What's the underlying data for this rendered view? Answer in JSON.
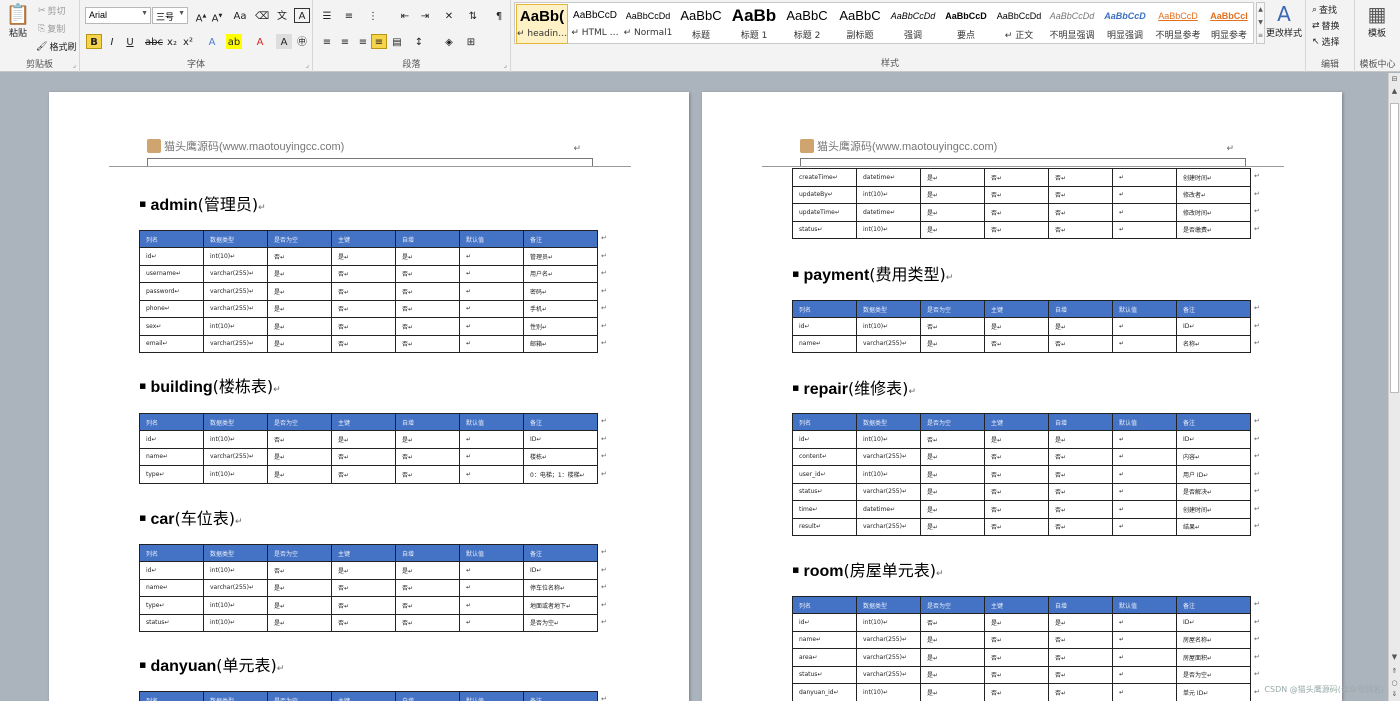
{
  "ribbon": {
    "clipboard": {
      "paste": "粘贴",
      "cut": "剪切",
      "copy": "复制",
      "format_painter": "格式刷",
      "label": "剪贴板"
    },
    "font": {
      "name": "Arial",
      "size": "三号",
      "label": "字体"
    },
    "paragraph": {
      "label": "段落"
    },
    "styles": {
      "label": "样式",
      "items": [
        {
          "preview": "AaBb(",
          "name": "↵ headin…"
        },
        {
          "preview": "AaBbCcD",
          "name": "↵ HTML …"
        },
        {
          "preview": "AaBbCcDd",
          "name": "↵ Normal1"
        },
        {
          "preview": "AaBbC",
          "name": "标题"
        },
        {
          "preview": "AaBb",
          "name": "标题 1"
        },
        {
          "preview": "AaBbC",
          "name": "标题 2"
        },
        {
          "preview": "AaBbC",
          "name": "副标题"
        },
        {
          "preview": "AaBbCcDd",
          "name": "强调"
        },
        {
          "preview": "AaBbCcD",
          "name": "要点"
        },
        {
          "preview": "AaBbCcDd",
          "name": "↵ 正文"
        },
        {
          "preview": "AaBbCcDd",
          "name": "不明显强调"
        },
        {
          "preview": "AaBbCcD",
          "name": "明显强调"
        },
        {
          "preview": "AaBbCcD",
          "name": "不明显参考"
        },
        {
          "preview": "AaBbCcI",
          "name": "明显参考"
        }
      ],
      "change_styles": "更改样式"
    },
    "editing": {
      "find": "查找",
      "replace": "替换",
      "select": "选择",
      "label": "编辑"
    },
    "templates": {
      "button": "模板",
      "label": "模板中心"
    }
  },
  "document": {
    "header_text": "猫头鹰源码(www.maotouyingcc.com)",
    "para_mark": "↵",
    "columns": [
      "列名",
      "数据类型",
      "是否为空",
      "主键",
      "自增",
      "默认值",
      "备注"
    ],
    "page1": [
      {
        "name": "admin",
        "cn": "(管理员)",
        "rows": [
          [
            "id↵",
            "int(10)↵",
            "否↵",
            "是↵",
            "是↵",
            "↵",
            "管理员↵"
          ],
          [
            "username↵",
            "varchar(255)↵",
            "是↵",
            "否↵",
            "否↵",
            "↵",
            "用户名↵"
          ],
          [
            "password↵",
            "varchar(255)↵",
            "是↵",
            "否↵",
            "否↵",
            "↵",
            "密码↵"
          ],
          [
            "phone↵",
            "varchar(255)↵",
            "是↵",
            "否↵",
            "否↵",
            "↵",
            "手机↵"
          ],
          [
            "sex↵",
            "int(10)↵",
            "是↵",
            "否↵",
            "否↵",
            "↵",
            "性别↵"
          ],
          [
            "email↵",
            "varchar(255)↵",
            "是↵",
            "否↵",
            "否↵",
            "↵",
            "邮箱↵"
          ]
        ]
      },
      {
        "name": "building",
        "cn": "(楼栋表)",
        "rows": [
          [
            "id↵",
            "int(10)↵",
            "否↵",
            "是↵",
            "是↵",
            "↵",
            "ID↵"
          ],
          [
            "name↵",
            "varchar(255)↵",
            "是↵",
            "否↵",
            "否↵",
            "↵",
            "楼栋↵"
          ],
          [
            "type↵",
            "int(10)↵",
            "是↵",
            "否↵",
            "否↵",
            "↵",
            "0：电梯；1：楼梯↵"
          ]
        ]
      },
      {
        "name": "car",
        "cn": "(车位表)",
        "rows": [
          [
            "id↵",
            "int(10)↵",
            "否↵",
            "是↵",
            "是↵",
            "↵",
            "ID↵"
          ],
          [
            "name↵",
            "varchar(255)↵",
            "是↵",
            "否↵",
            "否↵",
            "↵",
            "停车位名称↵"
          ],
          [
            "type↵",
            "int(10)↵",
            "是↵",
            "否↵",
            "否↵",
            "↵",
            "地面或者地下↵"
          ],
          [
            "status↵",
            "int(10)↵",
            "是↵",
            "否↵",
            "否↵",
            "↵",
            "是否为空↵"
          ]
        ]
      },
      {
        "name": "danyuan",
        "cn": "(单元表)",
        "rows": []
      }
    ],
    "page2_cont": [
      [
        "createTime↵",
        "datetime↵",
        "是↵",
        "否↵",
        "否↵",
        "↵",
        "创建时间↵"
      ],
      [
        "updateBy↵",
        "int(10)↵",
        "是↵",
        "否↵",
        "否↵",
        "↵",
        "修改者↵"
      ],
      [
        "updateTime↵",
        "datetime↵",
        "是↵",
        "否↵",
        "否↵",
        "↵",
        "修改时间↵"
      ],
      [
        "status↵",
        "int(10)↵",
        "是↵",
        "否↵",
        "否↵",
        "↵",
        "是否缴费↵"
      ]
    ],
    "page2": [
      {
        "name": "payment",
        "cn": "(费用类型)",
        "rows": [
          [
            "id↵",
            "int(10)↵",
            "否↵",
            "是↵",
            "是↵",
            "↵",
            "ID↵"
          ],
          [
            "name↵",
            "varchar(255)↵",
            "是↵",
            "否↵",
            "否↵",
            "↵",
            "名称↵"
          ]
        ]
      },
      {
        "name": "repair",
        "cn": "(维修表)",
        "rows": [
          [
            "id↵",
            "int(10)↵",
            "否↵",
            "是↵",
            "是↵",
            "↵",
            "ID↵"
          ],
          [
            "content↵",
            "varchar(255)↵",
            "是↵",
            "否↵",
            "否↵",
            "↵",
            "内容↵"
          ],
          [
            "user_id↵",
            "int(10)↵",
            "是↵",
            "否↵",
            "否↵",
            "↵",
            "用户 ID↵"
          ],
          [
            "status↵",
            "varchar(255)↵",
            "是↵",
            "否↵",
            "否↵",
            "↵",
            "是否解决↵"
          ],
          [
            "time↵",
            "datetime↵",
            "是↵",
            "否↵",
            "否↵",
            "↵",
            "创建时间↵"
          ],
          [
            "result↵",
            "varchar(255)↵",
            "是↵",
            "否↵",
            "否↵",
            "↵",
            "结果↵"
          ]
        ]
      },
      {
        "name": "room",
        "cn": "(房屋单元表)",
        "rows": [
          [
            "id↵",
            "int(10)↵",
            "否↵",
            "是↵",
            "是↵",
            "↵",
            "ID↵"
          ],
          [
            "name↵",
            "varchar(255)↵",
            "是↵",
            "否↵",
            "否↵",
            "↵",
            "房屋名称↵"
          ],
          [
            "area↵",
            "varchar(255)↵",
            "是↵",
            "否↵",
            "否↵",
            "↵",
            "房屋面积↵"
          ],
          [
            "status↵",
            "varchar(255)↵",
            "是↵",
            "否↵",
            "否↵",
            "↵",
            "是否为空↵"
          ],
          [
            "danyuan_id↵",
            "int(10)↵",
            "是↵",
            "否↵",
            "否↵",
            "↵",
            "单元 ID↵"
          ]
        ]
      }
    ]
  },
  "watermark": "CSDN @猫头鹰源码(公众号同名)"
}
